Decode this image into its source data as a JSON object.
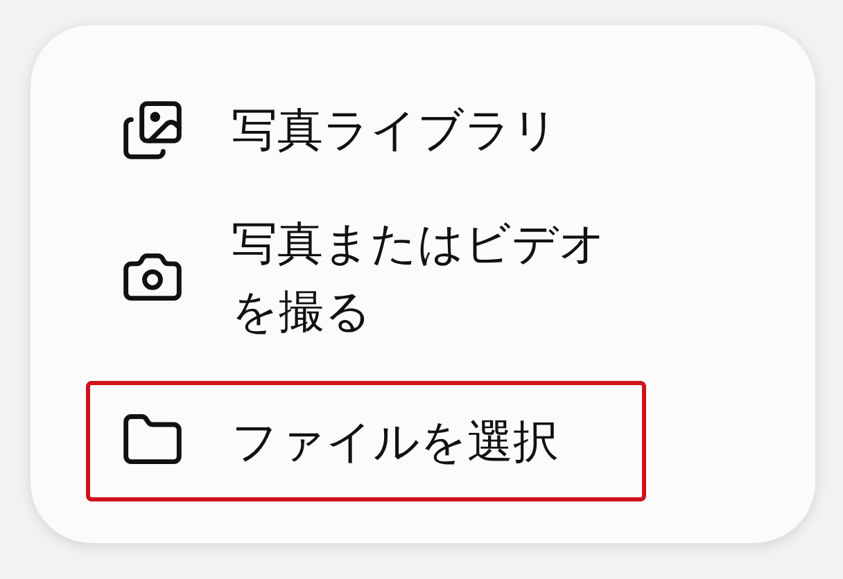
{
  "menu": {
    "items": [
      {
        "kind": "photos",
        "label": "写真ライブラリ",
        "selected": false
      },
      {
        "kind": "camera",
        "label": "写真またはビデオを撮る",
        "selected": false
      },
      {
        "kind": "folder",
        "label": "ファイルを選択",
        "selected": true
      }
    ]
  }
}
